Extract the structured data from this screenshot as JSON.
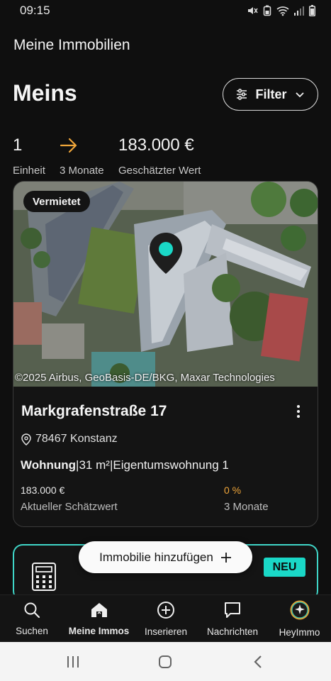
{
  "status_bar": {
    "time": "09:15"
  },
  "header": {
    "title": "Meine Immobilien"
  },
  "page": {
    "title": "Meins",
    "filter_label": "Filter"
  },
  "stats": {
    "units_value": "1",
    "units_label": "Einheit",
    "period_label": "3 Monate",
    "value_value": "183.000 €",
    "value_label": "Geschätzter Wert"
  },
  "property": {
    "status_badge": "Vermietet",
    "map_copyright": "©2025 Airbus, GeoBasis-DE/BKG, Maxar Technologies",
    "title": "Markgrafenstraße 17",
    "location": "78467 Konstanz",
    "type": "Wohnung",
    "area": "31 m²",
    "category": "Eigentumswohnung 1",
    "estimate_value": "183.000 €",
    "estimate_label": "Aktueller Schätzwert",
    "change_value": "0 %",
    "change_label": "3 Monate"
  },
  "promo": {
    "badge": "NEU"
  },
  "add_button": {
    "label": "Immobilie hinzufügen"
  },
  "bottom_nav": {
    "items": [
      {
        "label": "Suchen",
        "icon": "search-icon"
      },
      {
        "label": "Meine Immos",
        "icon": "home-icon"
      },
      {
        "label": "Inserieren",
        "icon": "plus-circle-icon"
      },
      {
        "label": "Nachrichten",
        "icon": "chat-icon"
      },
      {
        "label": "HeyImmo",
        "icon": "sparkle-icon"
      }
    ],
    "active": "Meine Immos"
  },
  "colors": {
    "accent_arrow": "#f0a63a",
    "accent_teal": "#1ad8c7",
    "background": "#0f0f0f",
    "change_value": "#f0a63a"
  }
}
